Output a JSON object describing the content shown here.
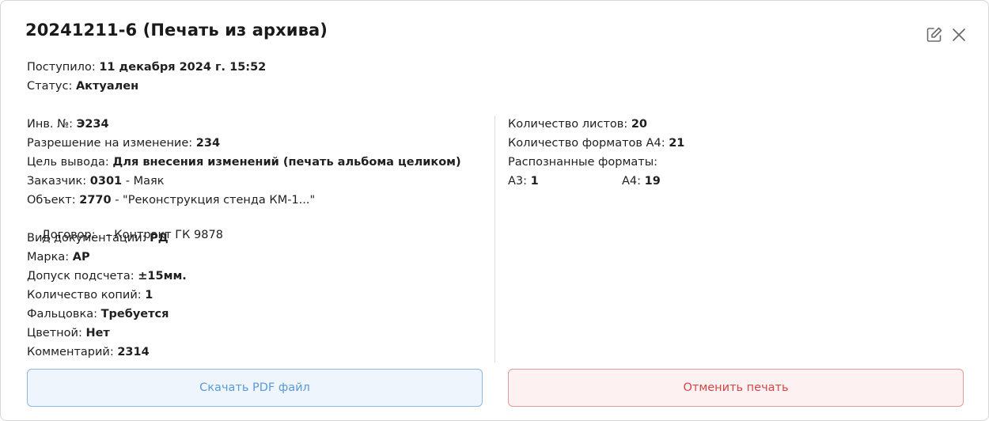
{
  "dialog": {
    "title": "20241211-6 (Печать из архива)"
  },
  "header": {
    "received_label": "Поступило: ",
    "received_value": "11 декабря 2024 г. 15:52",
    "status_label": "Статус: ",
    "status_value": "Актуален"
  },
  "left": {
    "inv_label": "Инв. №: ",
    "inv_value": "Э234",
    "permission_label": "Разрешение на изменение: ",
    "permission_value": "234",
    "purpose_label": "Цель вывода: ",
    "purpose_value": "Для внесения изменений (печать альбома целиком)",
    "customer_label": "Заказчик: ",
    "customer_code": "0301",
    "customer_name": " - Маяк",
    "object_label": "Объект: ",
    "object_code": "2770",
    "object_name": " - \"Реконструкция стенда КМ-1...\"",
    "contract_label": "Договор:  ",
    "contract_value": " - Контракт ГК 9878",
    "doc_type_label": "Вид документации: ",
    "doc_type_value": "РД",
    "mark_label": "Марка: ",
    "mark_value": "АР",
    "tolerance_label": "Допуск подсчета: ",
    "tolerance_value": "±15мм.",
    "copies_label": "Количество копий: ",
    "copies_value": "1",
    "folding_label": "Фальцовка: ",
    "folding_value": "Требуется",
    "color_label": "Цветной: ",
    "color_value": "Нет",
    "comment_label": "Комментарий: ",
    "comment_value": "2314"
  },
  "right": {
    "sheets_label": "Количество листов: ",
    "sheets_value": "20",
    "a4_count_label": "Количество форматов А4: ",
    "a4_count_value": "21",
    "recognized_label": "Распознанные форматы:",
    "a3_label": "А3: ",
    "a3_value": "1",
    "a4_label": "А4: ",
    "a4_value": "19"
  },
  "buttons": {
    "download_label": "Скачать PDF файл",
    "cancel_label": "Отменить печать"
  },
  "icons": {
    "edit": "edit-icon",
    "close": "close-icon"
  }
}
